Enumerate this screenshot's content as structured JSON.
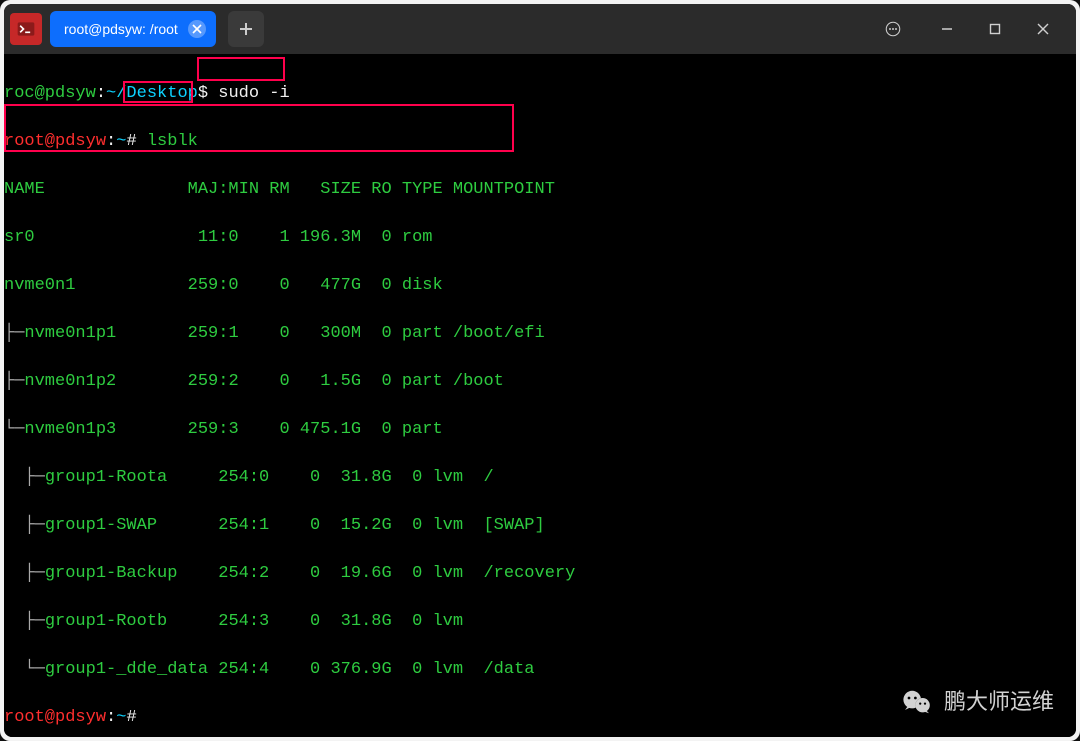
{
  "tab": {
    "title": "root@pdsyw: /root"
  },
  "prompt1": {
    "user": "roc@pdsyw",
    "sep": ":",
    "path": "~/Desktop",
    "marker": "$",
    "cmd": " sudo -i"
  },
  "prompt2": {
    "user": "root@pdsyw",
    "sep": ":",
    "path": "~",
    "marker": "#",
    "cmd": " lsblk"
  },
  "header": "NAME              MAJ:MIN RM   SIZE RO TYPE MOUNTPOINT",
  "rows": [
    "sr0                11:0    1 196.3M  0 rom  ",
    "nvme0n1           259:0    0   477G  0 disk ",
    "├─nvme0n1p1       259:1    0   300M  0 part /boot/efi",
    "├─nvme0n1p2       259:2    0   1.5G  0 part /boot",
    "└─nvme0n1p3       259:3    0 475.1G  0 part ",
    "  ├─group1-Roota     254:0    0  31.8G  0 lvm  /",
    "  ├─group1-SWAP      254:1    0  15.2G  0 lvm  [SWAP]",
    "  ├─group1-Backup    254:2    0  19.6G  0 lvm  /recovery",
    "  ├─group1-Rootb     254:3    0  31.8G  0 lvm  ",
    "  └─group1-_dde_data 254:4    0 376.9G  0 lvm  /data"
  ],
  "row_prefixes": [
    "",
    "",
    "├─",
    "├─",
    "└─",
    "  ├─",
    "  ├─",
    "  ├─",
    "  ├─",
    "  └─"
  ],
  "row_bodies": [
    "sr0                11:0    1 196.3M  0 rom  ",
    "nvme0n1           259:0    0   477G  0 disk ",
    "nvme0n1p1       259:1    0   300M  0 part /boot/efi",
    "nvme0n1p2       259:2    0   1.5G  0 part /boot",
    "nvme0n1p3       259:3    0 475.1G  0 part ",
    "group1-Roota     254:0    0  31.8G  0 lvm  /",
    "group1-SWAP      254:1    0  15.2G  0 lvm  [SWAP]",
    "group1-Backup    254:2    0  19.6G  0 lvm  /recovery",
    "group1-Rootb     254:3    0  31.8G  0 lvm  ",
    "group1-_dde_data 254:4    0 376.9G  0 lvm  /data"
  ],
  "prompt3": {
    "user": "root@pdsyw",
    "sep": ":",
    "path": "~",
    "marker": "#",
    "cmd": ""
  },
  "watermark": "鹏大师运维"
}
